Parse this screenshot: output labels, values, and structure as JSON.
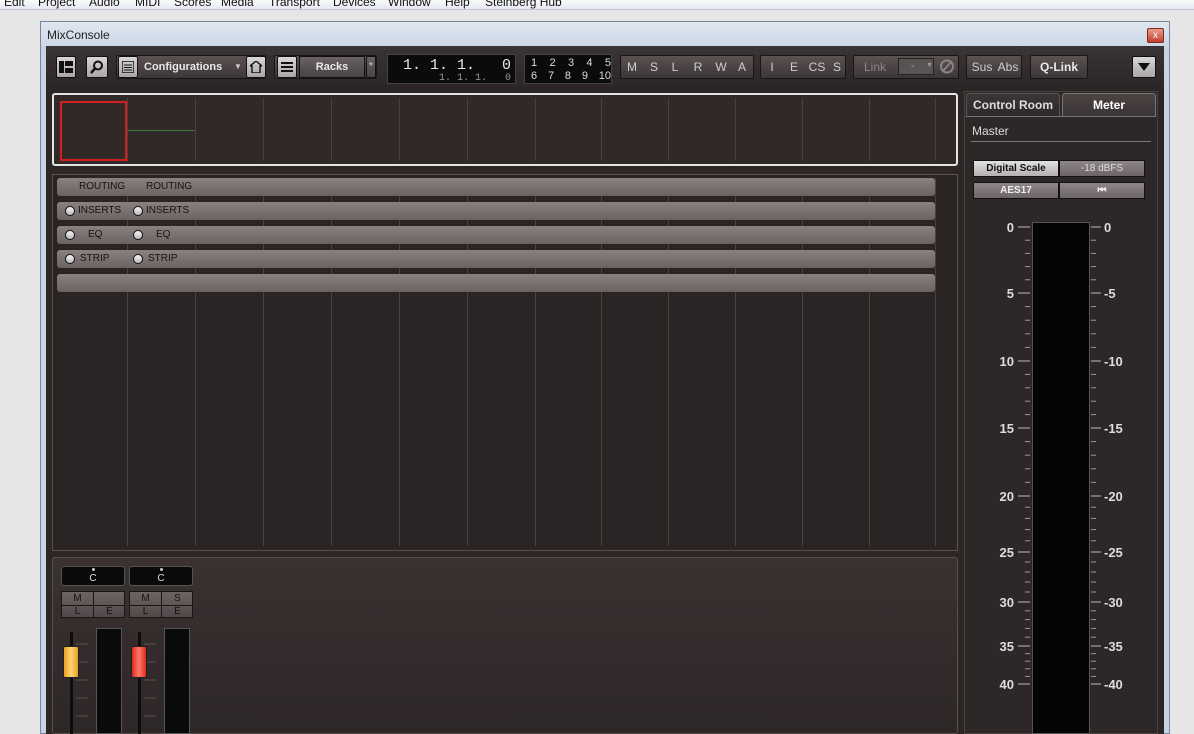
{
  "menu": [
    "Edit",
    "Project",
    "Audio",
    "MIDI",
    "Scores",
    "Media",
    "Transport",
    "Devices",
    "Window",
    "Help",
    "Steinberg Hub"
  ],
  "window": {
    "title": "MixConsole",
    "close": "x"
  },
  "toolbar": {
    "configurations": "Configurations",
    "racks": "Racks",
    "racks_extra": "*",
    "time_main": "1. 1. 1.   0",
    "time_sub": "1. 1. 1.   0",
    "num_top": [
      "1",
      "2",
      "3",
      "4",
      "5"
    ],
    "num_bottom": [
      "6",
      "7",
      "8",
      "9",
      "10"
    ],
    "msl": [
      "M",
      "S",
      "L"
    ],
    "rwa": [
      "R",
      "W",
      "A"
    ],
    "iecs": [
      "I",
      "E",
      "CS",
      "S"
    ],
    "link": "Link",
    "link_select": "-",
    "sus": "Sus",
    "abs": "Abs",
    "qlink": "Q-Link"
  },
  "racks": {
    "rows": [
      {
        "type": "header",
        "ch1": "ROUTING",
        "ch2": "ROUTING"
      },
      {
        "type": "radio",
        "ch1": "INSERTS",
        "ch2": "INSERTS"
      },
      {
        "type": "radio",
        "ch1": "EQ",
        "ch2": "EQ"
      },
      {
        "type": "radio",
        "ch1": "STRIP",
        "ch2": "STRIP"
      },
      {
        "type": "empty",
        "ch1": "",
        "ch2": ""
      }
    ]
  },
  "channels": [
    {
      "pan": "C",
      "msle": [
        "M",
        "",
        "L",
        "E"
      ],
      "fader_color": "#e8a21c"
    },
    {
      "pan": "C",
      "msle": [
        "M",
        "S",
        "L",
        "E"
      ],
      "fader_color": "#e0271d"
    }
  ],
  "right_panel": {
    "tabs": [
      "Control Room",
      "Meter"
    ],
    "active_tab": "Meter",
    "master": "Master",
    "digital_scale": "Digital Scale",
    "dbfs": "-18 dBFS",
    "aes": "AES17",
    "reset_icon": "⏮",
    "scale_labels": [
      "0",
      "5",
      "10",
      "15",
      "20",
      "25",
      "30",
      "35",
      "40"
    ]
  }
}
